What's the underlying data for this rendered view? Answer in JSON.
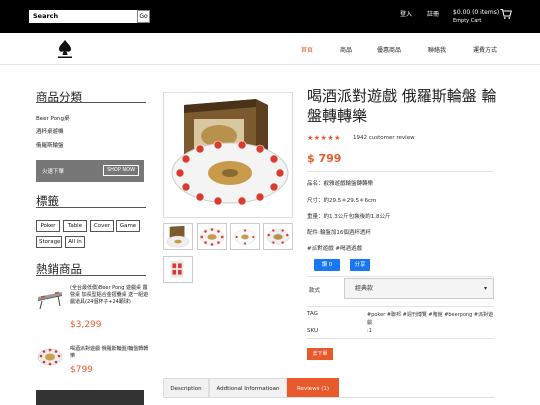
{
  "topbar": {
    "search_value": "Search",
    "search_button": "Go",
    "login": "登入",
    "register": "註冊",
    "cart_total": "$0.00 (0 items)",
    "cart_status": "Empty Cart"
  },
  "nav": {
    "items": [
      "首頁",
      "商品",
      "優惠商品",
      "聯絡我",
      "運費方式"
    ],
    "active_index": 0
  },
  "sidebar": {
    "categories_title": "商品分類",
    "categories": [
      "Beer Pong桌",
      "酒杯桌遊機",
      "俄羅斯輪盤"
    ],
    "banner_text": "火速下單",
    "banner_button": "SHOP NOW",
    "tags_title": "標籤",
    "tags": [
      "Poker",
      "Table",
      "Cover",
      "Game",
      "Storage",
      "All in"
    ],
    "hot_title": "熱銷商品",
    "hot_products": [
      {
        "name": "(全台最低價)Beer Pong 遊戲桌 露營桌 加長型鋁合金摺疊桌 送一組遊戲道具(24個杯子+24顆球)",
        "price": "$3,299"
      },
      {
        "name": "喝酒派對遊戲 俄羅斯輪盤/輪盤轉轉樂",
        "price": "$799"
      }
    ]
  },
  "product": {
    "title": "喝酒派對遊戲 俄羅斯輪盤 輪盤轉轉樂",
    "rating": 5,
    "stars": "★★★★★",
    "review_text": "1942 customer review",
    "price": "$ 799",
    "specs": [
      "品名：叡雅遊戲輪盤轉轉樂",
      "尺寸：約29.5＊29.5＊6cm",
      "重量：約1.3公斤包裝後約1.8公斤",
      "配件:輪盤加16個酒杯透杯",
      "#派對遊戲 #喝酒遊戲"
    ],
    "share_like": "讚 0",
    "share_share": "分享",
    "option_label": "款式",
    "option_value": "經典款",
    "tag_label": "TAG",
    "tag_value": "#poker #聯邦 #週刊博覽 #賭館 #beerpong #派對遊戲",
    "sku_label": "SKU",
    "sku_value": ":1",
    "add_to_cart": "去下單"
  },
  "tabs": [
    "Description",
    "Addtional Informatioan",
    "Reviews (1)"
  ],
  "active_tab": 2,
  "colors": {
    "accent": "#e8592b",
    "topbar": "#000000",
    "facebook": "#1877f2"
  }
}
